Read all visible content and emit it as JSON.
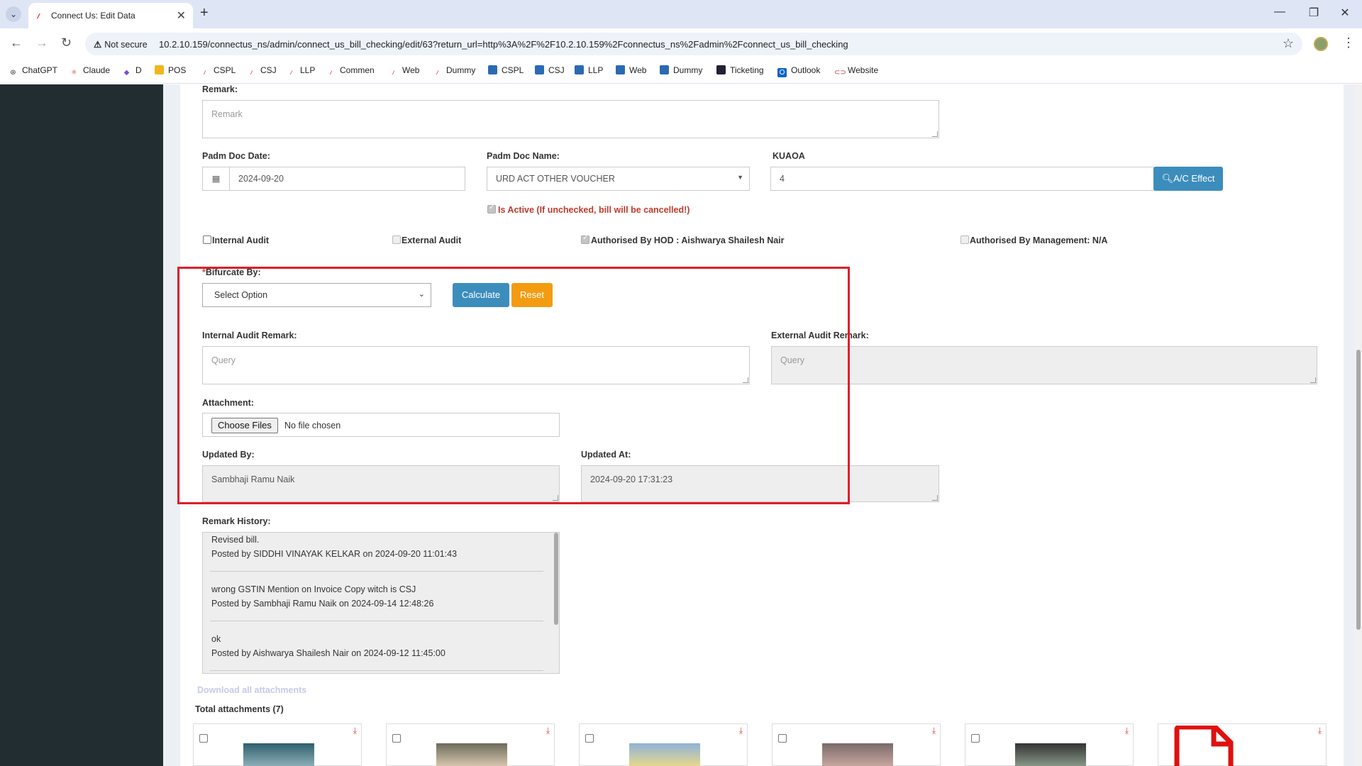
{
  "browser": {
    "tab_title": "Connect Us: Edit Data",
    "not_secure": "Not secure",
    "url": "10.2.10.159/connectus_ns/admin/connect_us_bill_checking/edit/63?return_url=http%3A%2F%2F10.2.10.159%2Fconnectus_ns%2Fadmin%2Fconnect_us_bill_checking",
    "bookmarks": [
      "ChatGPT",
      "Claude",
      "D",
      "POS",
      "CSPL",
      "CSJ",
      "LLP",
      "Commen",
      "Web",
      "Dummy",
      "CSPL",
      "CSJ",
      "LLP",
      "Web",
      "Dummy",
      "Ticketing",
      "Outlook",
      "Website"
    ]
  },
  "form": {
    "remark_label": "Remark:",
    "remark_placeholder": "Remark",
    "padm_doc_date_label": "Padm Doc Date:",
    "padm_doc_date_value": "2024-09-20",
    "padm_doc_name_label": "Padm Doc Name:",
    "padm_doc_name_value": "URD ACT OTHER VOUCHER",
    "kuaoa_label": "KUAOA",
    "kuaoa_value": "4",
    "ac_effect_label": "A/C Effect",
    "is_active_label": "Is Active (If unchecked, bill will be cancelled!)",
    "internal_audit_label": "Internal Audit",
    "external_audit_label": "External Audit",
    "authorised_hod_label": "Authorised By HOD : Aishwarya Shailesh Nair",
    "authorised_mgmt_label": "Authorised By Management: N/A",
    "bifurcate_required": "*",
    "bifurcate_label": "Bifurcate By:",
    "bifurcate_value": "Select Option",
    "calculate_label": "Calculate",
    "reset_label": "Reset",
    "internal_audit_remark_label": "Internal Audit Remark:",
    "internal_audit_remark_placeholder": "Query",
    "external_audit_remark_label": "External Audit Remark:",
    "external_audit_remark_placeholder": "Query",
    "attachment_label": "Attachment:",
    "choose_files_label": "Choose Files",
    "no_file_label": "No file chosen",
    "updated_by_label": "Updated By:",
    "updated_by_value": "Sambhaji Ramu Naik",
    "updated_at_label": "Updated At:",
    "updated_at_value": "2024-09-20 17:31:23",
    "remark_history_label": "Remark History:",
    "remark_history": [
      {
        "text": "Revised bill.",
        "posted": "Posted by SIDDHI VINAYAK KELKAR on 2024-09-20 11:01:43"
      },
      {
        "text": "wrong GSTIN Mention on Invoice Copy witch is CSJ",
        "posted": "Posted by Sambhaji Ramu Naik on 2024-09-14 12:48:26"
      },
      {
        "text": "ok",
        "posted": "Posted by Aishwarya Shailesh Nair on 2024-09-12 11:45:00"
      }
    ],
    "download_all_label": "Download all attachments",
    "total_attachments_label": "Total attachments (7)"
  },
  "colors": {
    "highlight": "#e01e2a",
    "primary_button": "#3c8dbc",
    "warning_button": "#f39c12",
    "sidebar": "#222d32"
  }
}
